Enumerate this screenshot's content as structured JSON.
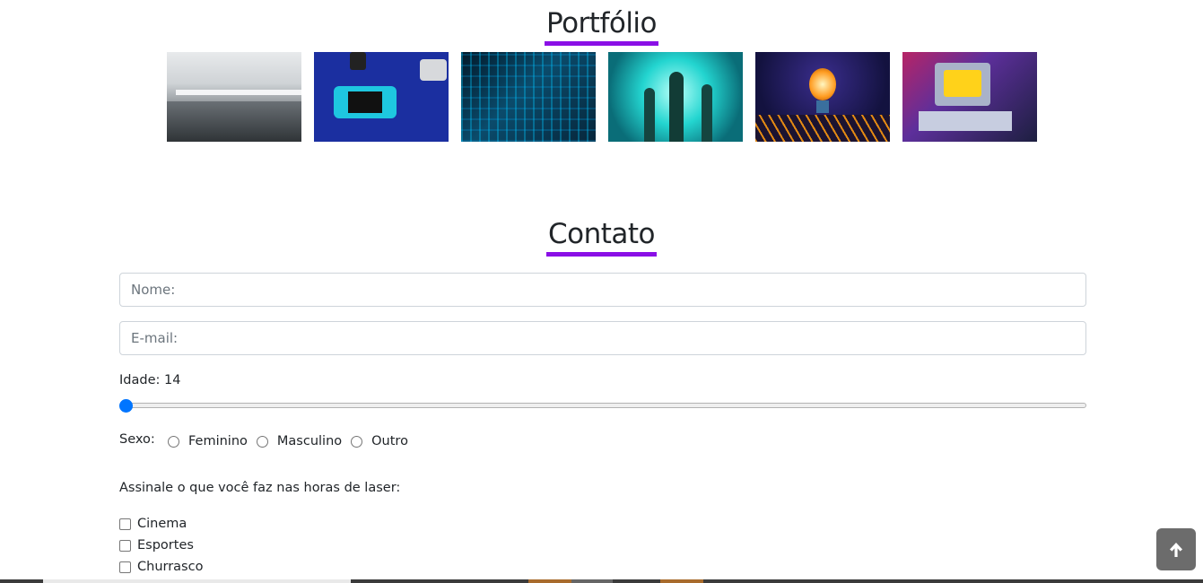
{
  "portfolio": {
    "title": "Portfólio",
    "images": [
      "office-image",
      "gaming-console-image",
      "city-network-image",
      "digital-people-image",
      "lightbulb-circuit-image",
      "retro-computer-image"
    ]
  },
  "contato": {
    "title": "Contato",
    "nome_placeholder": "Nome:",
    "email_placeholder": "E-mail:",
    "idade_label": "Idade: 14",
    "idade_value": 14,
    "sexo_label": "Sexo:",
    "sexo_options": [
      "Feminino",
      "Masculino",
      "Outro"
    ],
    "laser_label": "Assinale o que você faz nas horas de laser:",
    "laser_options": [
      "Cinema",
      "Esportes",
      "Churrasco"
    ]
  },
  "scroll_top": {
    "icon": "arrow-up-icon"
  },
  "colors": {
    "accent_underline": "#8a0fe6",
    "range_thumb": "#0075ff",
    "scroll_button": "#6c6c6c"
  }
}
